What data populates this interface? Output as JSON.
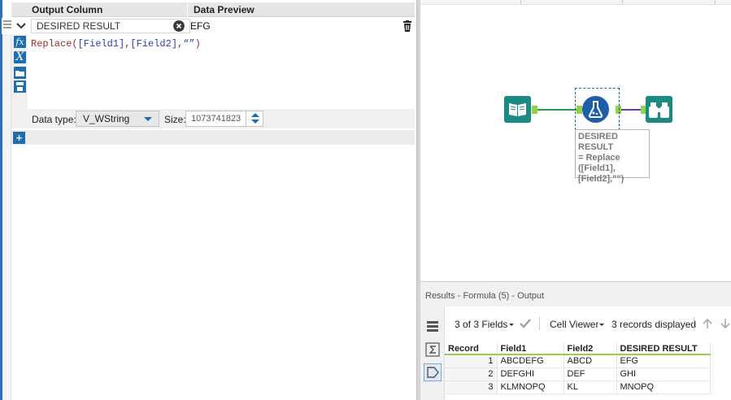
{
  "config": {
    "headers": {
      "output_column": "Output Column",
      "data_preview": "Data Preview"
    },
    "row": {
      "output_column_value": "DESIRED RESULT",
      "preview_value": "EFG"
    },
    "expression": {
      "fn": "Replace(",
      "field1": "[Field1]",
      "comma1": ",",
      "field2": "[Field2]",
      "comma2": ",",
      "literal": "“”",
      "close": ")"
    },
    "datatype": {
      "label": "Data type:",
      "value": "V_WString",
      "size_label": "Size:",
      "size_value": "1073741823"
    },
    "add_symbol": "+"
  },
  "canvas": {
    "annotation_lines": [
      "DESIRED RESULT",
      "= Replace",
      "([Field1],",
      "[Field2],\"\")"
    ]
  },
  "results": {
    "title": "Results - Formula (5) - Output",
    "fields_label": "3 of 3 Fields",
    "cell_viewer_label": "Cell Viewer",
    "records_label": "3 records displayed",
    "columns": [
      "Record",
      "Field1",
      "Field2",
      "DESIRED RESULT"
    ],
    "rows": [
      {
        "record": "1",
        "field1": "ABCDEFG",
        "field2": "ABCD",
        "result": "EFG"
      },
      {
        "record": "2",
        "field1": "DEFGHI",
        "field2": "DEF",
        "result": "GHI"
      },
      {
        "record": "3",
        "field1": "KLMNOPQ",
        "field2": "KL",
        "result": "MNOPQ"
      }
    ]
  },
  "colors": {
    "accent_blue": "#1a6fb3",
    "tool_teal": "#1b8a83",
    "anchor_green": "#8fd34a",
    "connector_purple": "#6b3fa0"
  }
}
